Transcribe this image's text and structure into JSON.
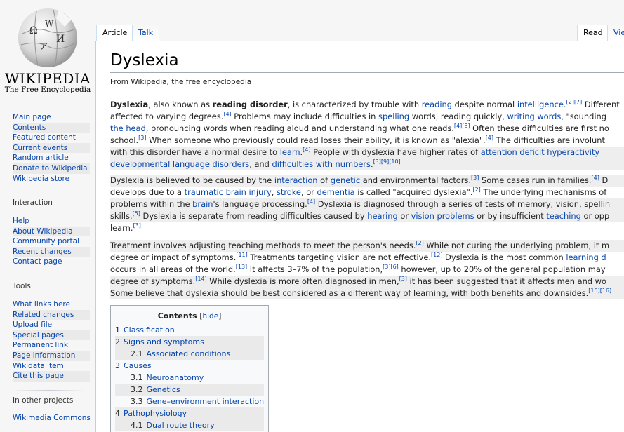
{
  "logo": {
    "wordmark": "WIKIPEDIA",
    "tagline": "The Free Encyclopedia"
  },
  "sidebar": {
    "nav": [
      "Main page",
      "Contents",
      "Featured content",
      "Current events",
      "Random article",
      "Donate to Wikipedia",
      "Wikipedia store"
    ],
    "interaction": {
      "heading": "Interaction",
      "items": [
        "Help",
        "About Wikipedia",
        "Community portal",
        "Recent changes",
        "Contact page"
      ]
    },
    "tools": {
      "heading": "Tools",
      "items": [
        "What links here",
        "Related changes",
        "Upload file",
        "Special pages",
        "Permanent link",
        "Page information",
        "Wikidata item",
        "Cite this page"
      ]
    },
    "other_projects": {
      "heading": "In other projects",
      "items": [
        "Wikimedia Commons"
      ]
    }
  },
  "tabs": {
    "article": "Article",
    "talk": "Talk",
    "read": "Read",
    "view": "Vie"
  },
  "article": {
    "title": "Dyslexia",
    "tagline": "From Wikipedia, the free encyclopedia",
    "p1": [
      [
        "b:Dyslexia",
        ", also known as ",
        "b:reading disorder",
        ", is characterized by trouble with ",
        "l:reading",
        " despite normal ",
        "l:intelligence",
        ".",
        "s:[2][7]",
        " Different"
      ],
      [
        "affected to varying degrees.",
        "s:[4]",
        " Problems may include difficulties in ",
        "l:spelling",
        " words, reading quickly, ",
        "l:writing words",
        ", \"sounding "
      ],
      [
        "l:the head",
        ", pronouncing words when reading aloud and understanding what one reads.",
        "s:[4][8]",
        " Often these difficulties are first no"
      ],
      [
        "school.",
        "s:[3]",
        " When someone who previously could read loses their ability, it is known as \"alexia\".",
        "s:[4]",
        " The difficulties are involunt"
      ],
      [
        "with this disorder have a normal desire to ",
        "l:learn",
        ".",
        "s:[4]",
        " People with dyslexia have higher rates of ",
        "l:attention deficit hyperactivity"
      ],
      [
        "l:developmental language disorders",
        ", and ",
        "l:difficulties with numbers",
        ".",
        "s:[3][9][10]"
      ]
    ],
    "p2": [
      [
        "Dyslexia is believed to be caused by the ",
        "l:interaction",
        " of ",
        "l:genetic",
        " and environmental factors.",
        "s:[3]",
        " Some cases run in families.",
        "s:[4]",
        " D"
      ],
      [
        "develops due to a ",
        "l:traumatic brain injury",
        ", ",
        "l:stroke",
        ", or ",
        "l:dementia",
        " is called \"acquired dyslexia\".",
        "s:[2]",
        " The underlying mechanisms of"
      ],
      [
        "problems within the ",
        "l:brain",
        "'s language processing.",
        "s:[4]",
        " Dyslexia is diagnosed through a series of tests of memory, vision, spellin"
      ],
      [
        "skills.",
        "s:[5]",
        " Dyslexia is separate from reading difficulties caused by ",
        "l:hearing",
        " or ",
        "l:vision problems",
        " or by insufficient ",
        "l:teaching",
        " or opp"
      ],
      [
        "learn.",
        "s:[3]"
      ]
    ],
    "p3": [
      [
        "Treatment involves adjusting teaching methods to meet the person's needs.",
        "s:[2]",
        " While not curing the underlying problem, it m"
      ],
      [
        "degree or impact of symptoms.",
        "s:[11]",
        " Treatments targeting vision are not effective.",
        "s:[12]",
        " Dyslexia is the most common ",
        "l:learning d"
      ],
      [
        "occurs in all areas of the world.",
        "s:[13]",
        " It affects 3–7% of the population,",
        "s:[3][6]",
        " however, up to 20% of the general population may"
      ],
      [
        "degree of symptoms.",
        "s:[14]",
        " While dyslexia is more often diagnosed in men,",
        "s:[3]",
        " it has been suggested that it affects men and wo"
      ],
      [
        "Some believe that dyslexia should be best considered as a different way of learning, with both benefits and downsides.",
        "s:[15][16]"
      ]
    ]
  },
  "toc": {
    "title": "Contents",
    "hide": "hide",
    "items": [
      {
        "num": "1",
        "label": "Classification"
      },
      {
        "num": "2",
        "label": "Signs and symptoms"
      },
      {
        "num": "2.1",
        "label": "Associated conditions",
        "sub": true
      },
      {
        "num": "3",
        "label": "Causes"
      },
      {
        "num": "3.1",
        "label": "Neuroanatomy",
        "sub": true
      },
      {
        "num": "3.2",
        "label": "Genetics",
        "sub": true
      },
      {
        "num": "3.3",
        "label": "Gene–environment interaction",
        "sub": true
      },
      {
        "num": "4",
        "label": "Pathophysiology"
      },
      {
        "num": "4.1",
        "label": "Dual route theory",
        "sub": true
      }
    ]
  }
}
